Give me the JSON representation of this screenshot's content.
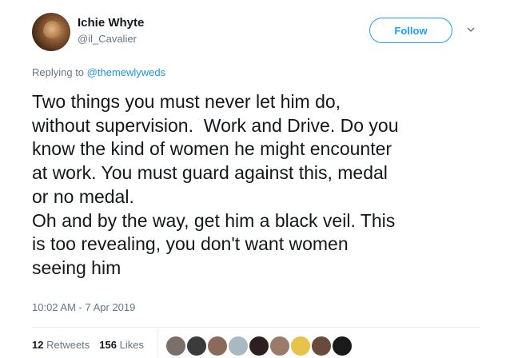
{
  "user": {
    "display_name": "Ichie Whyte",
    "handle": "@il_Cavalier"
  },
  "follow_button": {
    "label": "Follow"
  },
  "reply": {
    "prefix": "Replying to",
    "mention": "@themewlyweds"
  },
  "tweet": {
    "text": "Two things you must never let him do,\nwithout supervision.  Work and Drive. Do you\nknow the kind of women he might encounter\nat work. You must guard against this, medal\nor no medal.\nOh and by the way, get him a black veil. This\nis too revealing, you don't want women\nseeing him",
    "timestamp": "10:02 AM - 7 Apr 2019"
  },
  "stats": {
    "retweets_count": "12",
    "retweets_label": "Retweets",
    "likes_count": "156",
    "likes_label": "Likes"
  },
  "likers": [
    {
      "name": "liker-avatar-1",
      "color": "#7a6f6a"
    },
    {
      "name": "liker-avatar-2",
      "color": "#3b3b3b"
    },
    {
      "name": "liker-avatar-3",
      "color": "#8a6a5a"
    },
    {
      "name": "liker-avatar-4",
      "color": "#aab8c2"
    },
    {
      "name": "liker-avatar-5",
      "color": "#2b1f22"
    },
    {
      "name": "liker-avatar-6",
      "color": "#9a7b6a"
    },
    {
      "name": "liker-avatar-7",
      "color": "#e8c24a"
    },
    {
      "name": "liker-avatar-8",
      "color": "#6a4a3a"
    },
    {
      "name": "liker-avatar-9",
      "color": "#1a1a1a"
    }
  ],
  "colors": {
    "accent": "#1da1f2",
    "mention": "#1b95e0",
    "secondary_text": "#657786"
  }
}
